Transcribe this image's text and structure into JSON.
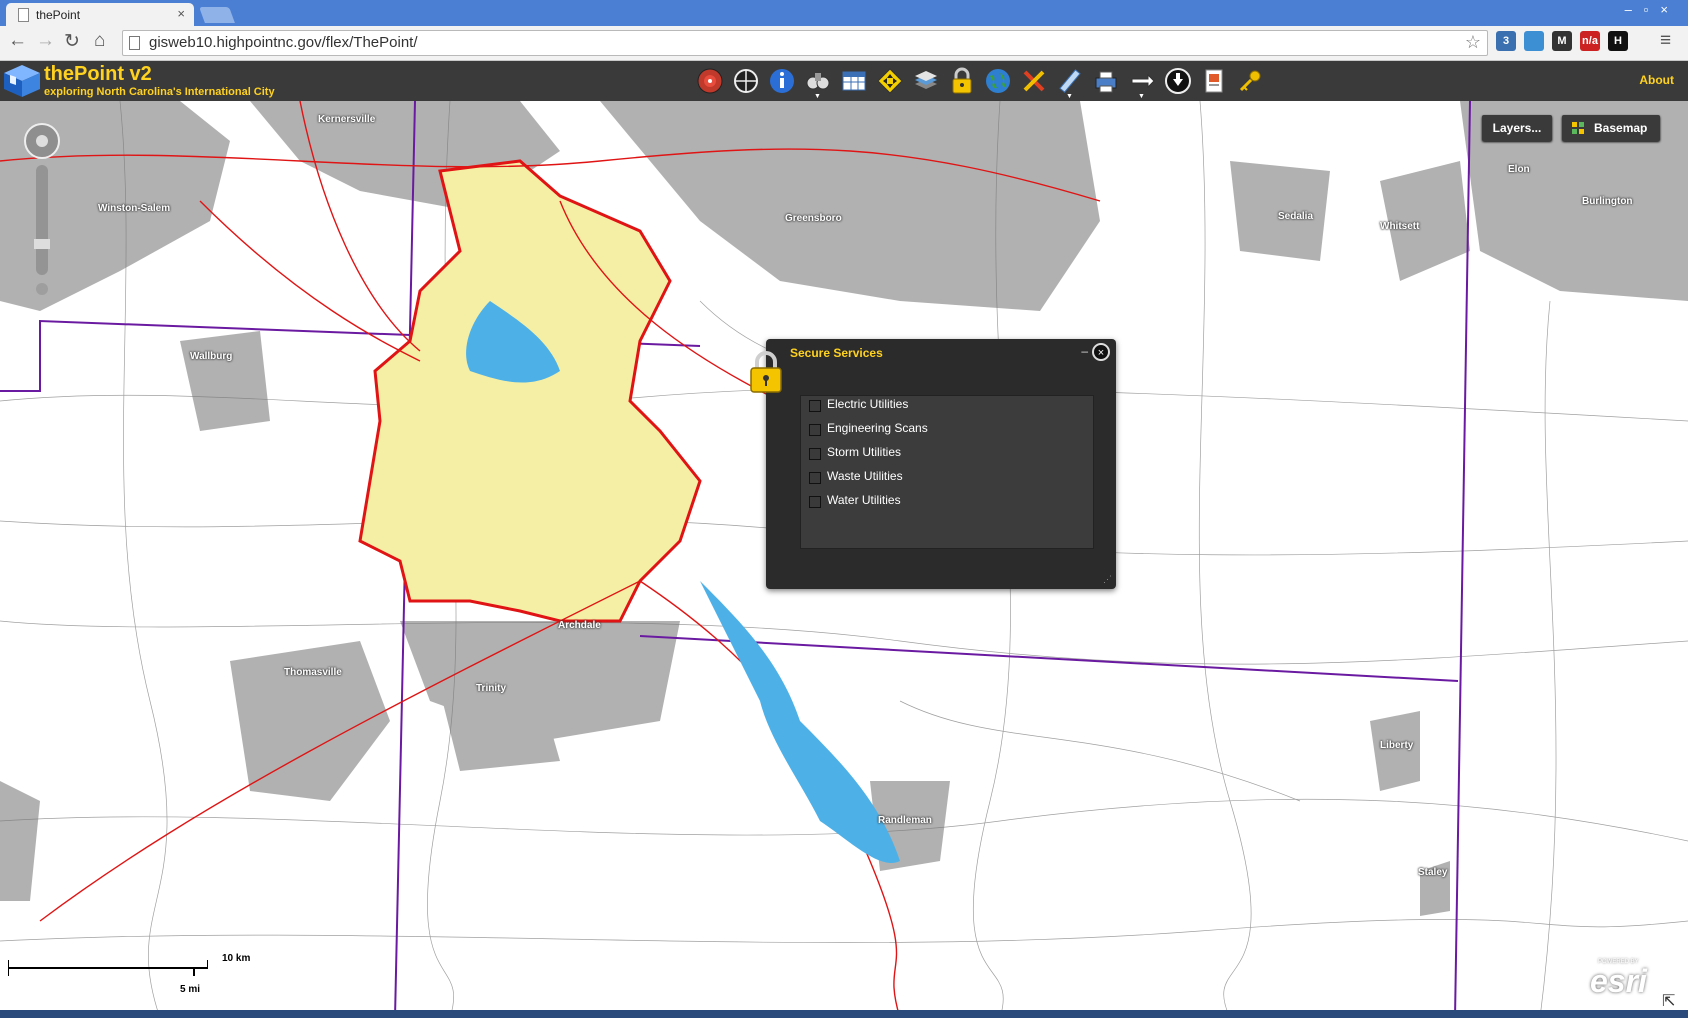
{
  "browser": {
    "tab_title": "thePoint",
    "tab_close": "×",
    "url": "gisweb10.highpointnc.gov/flex/ThePoint/",
    "window_controls": "–▫×",
    "nav": {
      "back": "←",
      "forward": "→",
      "reload": "↻",
      "home": "⌂",
      "menu": "≡",
      "star": "☆"
    },
    "extensions": [
      {
        "name": "magnifier-badge-icon",
        "label": "3",
        "color": "#3a6fb0"
      },
      {
        "name": "puzzle-extension-icon",
        "label": "",
        "color": "#3d8fd4"
      },
      {
        "name": "m-extension-icon",
        "label": "M",
        "color": "#333333"
      },
      {
        "name": "wp-extension-icon",
        "label": "n/a",
        "color": "#cc2222"
      },
      {
        "name": "h-extension-icon",
        "label": "H",
        "color": "#111111"
      }
    ]
  },
  "app": {
    "title": "thePoint v2",
    "subtitle": "exploring North Carolina's International City",
    "about": "About",
    "accent": "#ffd21f",
    "toolbar": [
      "bullseye-icon",
      "crosshair-icon",
      "info-icon",
      "binoculars-icon",
      "table-icon",
      "move-arrows-icon",
      "layers-stack-icon",
      "lock-icon",
      "globe-icon",
      "tools-icon",
      "measure-icon",
      "print-icon",
      "pointer-hand-icon",
      "download-icon",
      "report-icon",
      "key-icon"
    ]
  },
  "map": {
    "layers_button": "Layers...",
    "basemap_button": "Basemap",
    "scale_km": "10 km",
    "scale_mi": "5 mi",
    "esri_powered": "POWERED BY",
    "esri": "esri",
    "resize": "⇱",
    "towns": [
      "Kernersville",
      "Winston-Salem",
      "Greensboro",
      "Sedalia",
      "Whitsett",
      "Elon",
      "Burlington",
      "Wallburg",
      "Archdale",
      "Thomasville",
      "Trinity",
      "Randleman",
      "Liberty",
      "Staley"
    ]
  },
  "secure_panel": {
    "title": "Secure Services",
    "minimize": "–",
    "close": "×",
    "grip": "⋰",
    "items": [
      {
        "label": "Electric Utilities",
        "checked": false
      },
      {
        "label": "Engineering Scans",
        "checked": false
      },
      {
        "label": "Storm Utilities",
        "checked": false
      },
      {
        "label": "Waste Utilities",
        "checked": false
      },
      {
        "label": "Water Utilities",
        "checked": false
      }
    ]
  }
}
